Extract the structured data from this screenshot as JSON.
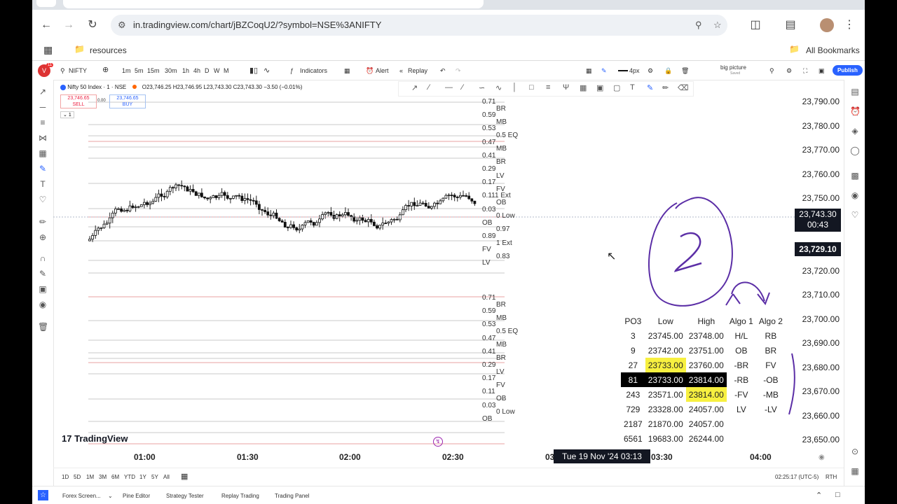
{
  "browser": {
    "url": "in.tradingview.com/chart/jBZCoqU2/?symbol=NSE%3ANIFTY",
    "bookmark_folder": "resources",
    "all_bookmarks": "All Bookmarks"
  },
  "toolbar": {
    "badge": "11",
    "symbol": "NIFTY",
    "intervals": [
      "1m",
      "5m",
      "15m",
      "30m",
      "1h",
      "4h",
      "D",
      "W",
      "M"
    ],
    "indicators": "Indicators",
    "alert": "Alert",
    "replay": "Replay",
    "stroke": "4px",
    "layout_name": "big picture",
    "layout_sub": "Saved",
    "publish": "Publish"
  },
  "legend": {
    "title": "Nifty 50 Index · 1 · NSE",
    "ohlc": "O23,746.25 H23,746.95 L23,743.30 C23,743.30 −3.50 (−0.01%)",
    "sell_price": "23,746.65",
    "sell_label": "SELL",
    "spread": "0.00",
    "buy_price": "23,746.65",
    "buy_label": "BUY",
    "count": "1"
  },
  "price_scale": {
    "labels": [
      "23,790.00",
      "23,780.00",
      "23,770.00",
      "23,760.00",
      "23,750.00",
      "23,720.00",
      "23,710.00",
      "23,700.00",
      "23,690.00",
      "23,680.00",
      "23,670.00",
      "23,660.00",
      "23,650.00"
    ],
    "current_price": "23,743.30",
    "current_countdown": "00:43",
    "crosshair_price": "23,729.10"
  },
  "time_axis": {
    "labels": [
      "01:00",
      "01:30",
      "02:00",
      "02:30",
      "03",
      "03:30",
      "04:00"
    ],
    "crosshair_time": "Tue 19 Nov '24   03:13"
  },
  "fib_labels_upper": [
    "0.71",
    "BR",
    "0.59",
    "MB",
    "0.53",
    "0.5 EQ",
    "0.47",
    "MB",
    "0.41",
    "BR",
    "0.29",
    "LV",
    "0.17",
    "FV",
    "0.111 Ext",
    "OB",
    "0.03",
    "0 Low",
    "OB",
    "0.97",
    "0.89",
    "1 Ext",
    "FV",
    "0.83",
    "LV"
  ],
  "fib_labels_lower": [
    "0.71",
    "BR",
    "0.59",
    "MB",
    "0.53",
    "0.5 EQ",
    "0.47",
    "MB",
    "0.41",
    "BR",
    "0.29",
    "LV",
    "0.17",
    "FV",
    "0.11",
    "OB",
    "0.03",
    "0 Low",
    "OB"
  ],
  "table": {
    "headers": [
      "PO3",
      "Low",
      "High",
      "Algo 1",
      "Algo 2"
    ],
    "rows": [
      [
        "3",
        "23745.00",
        "23748.00",
        "H/L",
        "RB"
      ],
      [
        "9",
        "23742.00",
        "23751.00",
        "OB",
        "BR"
      ],
      [
        "27",
        "23733.00",
        "23760.00",
        "-BR",
        "FV"
      ],
      [
        "81",
        "23733.00",
        "23814.00",
        "-RB",
        "-OB"
      ],
      [
        "243",
        "23571.00",
        "23814.00",
        "-FV",
        "-MB"
      ],
      [
        "729",
        "23328.00",
        "24057.00",
        "LV",
        "-LV"
      ],
      [
        "2187",
        "21870.00",
        "24057.00",
        "",
        ""
      ],
      [
        "6561",
        "19683.00",
        "26244.00",
        "",
        ""
      ]
    ]
  },
  "watermark": "TradingView",
  "bottom": {
    "ranges": [
      "1D",
      "5D",
      "1M",
      "3M",
      "6M",
      "YTD",
      "1Y",
      "5Y",
      "All"
    ],
    "clock": "02:25:17 (UTC-5)",
    "session": "RTH"
  },
  "footer": {
    "tabs": [
      "Forex Screen...",
      "Pine Editor",
      "Strategy Tester",
      "Replay Trading",
      "Trading Panel"
    ]
  },
  "colors": {
    "accent": "#2962ff",
    "highlight": "#f7f040",
    "annotation": "#5b2ea6"
  }
}
